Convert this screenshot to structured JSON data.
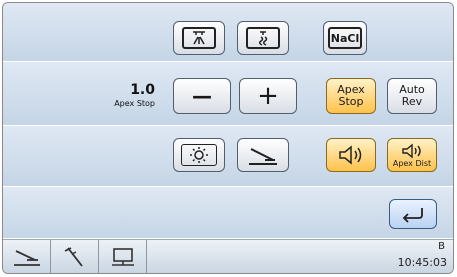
{
  "apex": {
    "value": "1.0",
    "label": "Apex Stop"
  },
  "buttons": {
    "nacl": "NaCl",
    "apex_stop": [
      "Apex",
      "Stop"
    ],
    "auto_rev": [
      "Auto",
      "Rev"
    ],
    "apex_dist": "Apex Dist",
    "minus": "—",
    "plus": "+"
  },
  "status": {
    "letter": "B",
    "time": "10:45:03"
  },
  "colors": {
    "orange_active": "#ffc24a",
    "panel": "#d0dcea",
    "border": "#4f5e70"
  },
  "icons": [
    "spray-icon",
    "water-drop-icon",
    "light-icon",
    "foot-pedal-icon",
    "speaker-icon",
    "return-icon",
    "instrument-icon",
    "tool-icon",
    "monitor-icon"
  ]
}
